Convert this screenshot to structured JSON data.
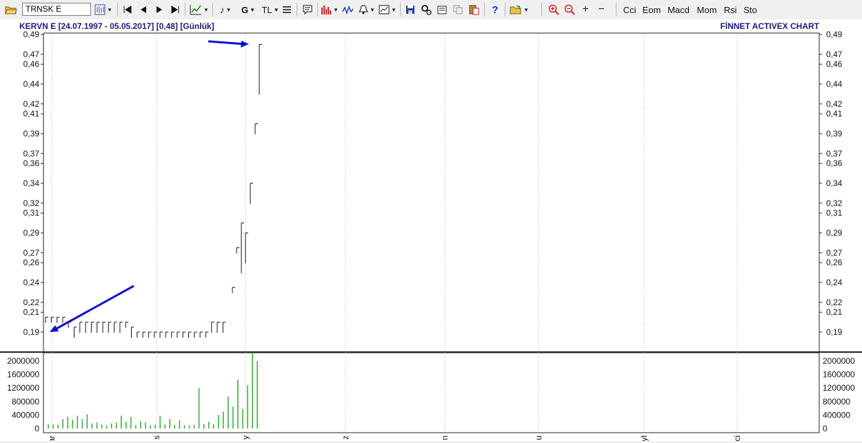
{
  "toolbar": {
    "symbol_value": "TRNSK E",
    "g_label": "G",
    "tl_label": "TL",
    "indicators": [
      "Cci",
      "Eom",
      "Macd",
      "Mom",
      "Rsi",
      "Sto"
    ]
  },
  "chart": {
    "header_left": "KERVN E  [24.07.1997 - 05.05.2017]  [0,48]  [Günlük]",
    "header_right": "FİNNET ACTIVEX CHART",
    "price_axis_labels": [
      "0,49",
      "0,47",
      "0,46",
      "0,44",
      "0,42",
      "0,41",
      "0,39",
      "0,37",
      "0,36",
      "0,34",
      "0,32",
      "0,31",
      "0,29",
      "0,27",
      "0,26",
      "0,24",
      "0,22",
      "0,21",
      "0,19"
    ],
    "volume_axis_labels": [
      "2000000",
      "1600000",
      "1200000",
      "800000",
      "400000",
      "0"
    ],
    "x_tick_labels": [
      "ar",
      "s",
      "y",
      "z",
      "n",
      "u",
      "yl",
      "ci"
    ],
    "arrow_color": "#1010c8",
    "volume_color": "#33aa33"
  },
  "chart_data": {
    "type": "bar",
    "price_bars": [
      {
        "high": 0.205,
        "low": 0.2
      },
      {
        "high": 0.205,
        "low": 0.2
      },
      {
        "high": 0.205,
        "low": 0.2
      },
      {
        "high": 0.205,
        "low": 0.2
      },
      {
        "high": 0.2,
        "low": 0.195
      },
      {
        "high": 0.195,
        "low": 0.185
      },
      {
        "high": 0.2,
        "low": 0.19
      },
      {
        "high": 0.2,
        "low": 0.19
      },
      {
        "high": 0.2,
        "low": 0.19
      },
      {
        "high": 0.2,
        "low": 0.19
      },
      {
        "high": 0.2,
        "low": 0.19
      },
      {
        "high": 0.2,
        "low": 0.19
      },
      {
        "high": 0.2,
        "low": 0.19
      },
      {
        "high": 0.2,
        "low": 0.19
      },
      {
        "high": 0.2,
        "low": 0.195
      },
      {
        "high": 0.195,
        "low": 0.185
      },
      {
        "high": 0.19,
        "low": 0.185
      },
      {
        "high": 0.19,
        "low": 0.185
      },
      {
        "high": 0.19,
        "low": 0.185
      },
      {
        "high": 0.19,
        "low": 0.185
      },
      {
        "high": 0.19,
        "low": 0.185
      },
      {
        "high": 0.19,
        "low": 0.185
      },
      {
        "high": 0.19,
        "low": 0.185
      },
      {
        "high": 0.19,
        "low": 0.185
      },
      {
        "high": 0.19,
        "low": 0.185
      },
      {
        "high": 0.19,
        "low": 0.185
      },
      {
        "high": 0.19,
        "low": 0.185
      },
      {
        "high": 0.19,
        "low": 0.185
      },
      {
        "high": 0.19,
        "low": 0.185
      },
      {
        "high": 0.2,
        "low": 0.19
      },
      {
        "high": 0.2,
        "low": 0.19
      },
      {
        "high": 0.2,
        "low": 0.19
      },
      {
        "high": 0.235,
        "low": 0.23
      },
      {
        "high": 0.275,
        "low": 0.27
      },
      {
        "high": 0.3,
        "low": 0.25
      },
      {
        "high": 0.29,
        "low": 0.26
      },
      {
        "high": 0.34,
        "low": 0.32
      },
      {
        "high": 0.4,
        "low": 0.39
      },
      {
        "high": 0.48,
        "low": 0.43
      }
    ],
    "volume_values": [
      130000,
      120000,
      110000,
      280000,
      350000,
      260000,
      380000,
      280000,
      420000,
      150000,
      180000,
      120000,
      90000,
      150000,
      180000,
      380000,
      200000,
      340000,
      100000,
      210000,
      180000,
      90000,
      110000,
      380000,
      120000,
      280000,
      110000,
      240000,
      100000,
      90000,
      110000,
      1200000,
      140000,
      200000,
      120000,
      400000,
      500000,
      950000,
      650000,
      1450000,
      580000,
      1280000,
      2250000,
      2000000
    ],
    "price_ylim": [
      0.185,
      0.49
    ],
    "volume_ylim": [
      0,
      2250000
    ]
  }
}
